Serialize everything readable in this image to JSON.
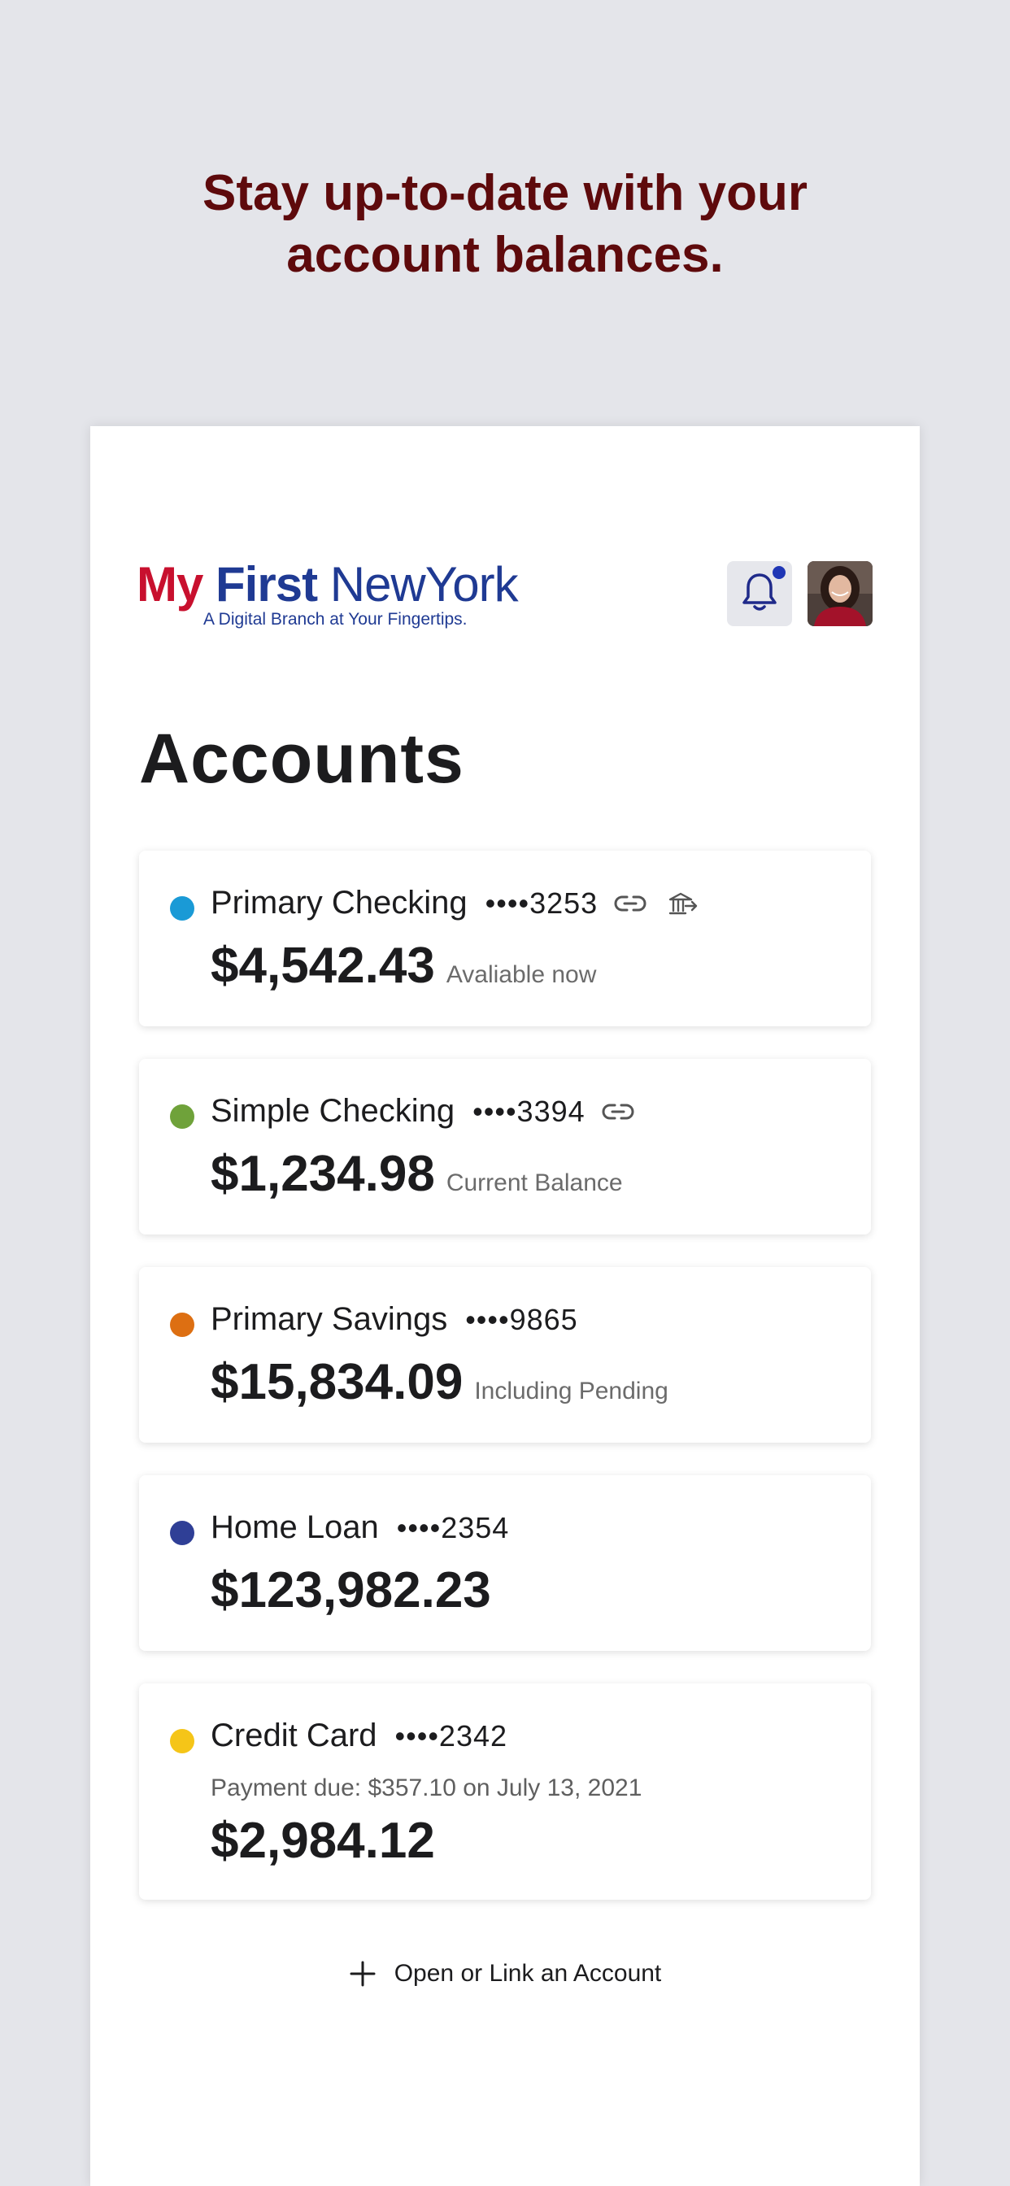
{
  "promo": {
    "line1": "Stay up-to-date with your",
    "line2": "account balances."
  },
  "header": {
    "logo": {
      "my": "My",
      "first": "First",
      "new_york": "NewYork",
      "tagline": "A Digital Branch at Your Fingertips."
    },
    "notifications_icon": "bell-icon",
    "has_unread": true,
    "avatar": "user-avatar"
  },
  "page_title": "Accounts",
  "accounts": [
    {
      "name": "Primary Checking",
      "mask": "••••3253",
      "balance": "$4,542.43",
      "note": "Avaliable now",
      "color": "#1a9ad6",
      "icons": [
        "link-icon",
        "bank-transfer-icon"
      ]
    },
    {
      "name": "Simple Checking",
      "mask": "••••3394",
      "balance": "$1,234.98",
      "note": "Current Balance",
      "color": "#6fa23a",
      "icons": [
        "link-icon"
      ]
    },
    {
      "name": "Primary Savings",
      "mask": "••••9865",
      "balance": "$15,834.09",
      "note": "Including Pending",
      "color": "#dd6f12",
      "icons": []
    },
    {
      "name": "Home Loan",
      "mask": "••••2354",
      "balance": "$123,982.23",
      "note": "",
      "color": "#2f3f96",
      "icons": []
    },
    {
      "name": "Credit Card",
      "mask": "••••2342",
      "due": "Payment due: $357.10 on July 13, 2021",
      "balance": "$2,984.12",
      "note": "",
      "color": "#f5c518",
      "icons": []
    }
  ],
  "open_link_label": "Open or Link an Account",
  "colors": {
    "background": "#e4e5ea",
    "headline": "#5e0a0c",
    "brand_red": "#c8102e",
    "brand_blue": "#1f3a93",
    "notification_dot": "#1f36b5"
  }
}
